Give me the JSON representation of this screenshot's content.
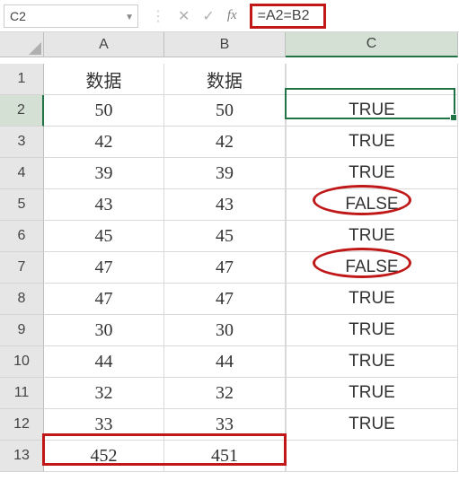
{
  "formula_bar": {
    "name_box": "C2",
    "formula": "=A2=B2"
  },
  "columns": [
    "A",
    "B",
    "C"
  ],
  "rows_header": [
    "1",
    "2",
    "3",
    "4",
    "5",
    "6",
    "7",
    "8",
    "9",
    "10",
    "11",
    "12",
    "13"
  ],
  "header_row": {
    "A": "数据",
    "B": "数据",
    "C": ""
  },
  "data": [
    {
      "A": "50",
      "B": "50",
      "C": "TRUE"
    },
    {
      "A": "42",
      "B": "42",
      "C": "TRUE"
    },
    {
      "A": "39",
      "B": "39",
      "C": "TRUE"
    },
    {
      "A": "43",
      "B": "43",
      "C": "FALSE"
    },
    {
      "A": "45",
      "B": "45",
      "C": "TRUE"
    },
    {
      "A": "47",
      "B": "47",
      "C": "FALSE"
    },
    {
      "A": "47",
      "B": "47",
      "C": "TRUE"
    },
    {
      "A": "30",
      "B": "30",
      "C": "TRUE"
    },
    {
      "A": "44",
      "B": "44",
      "C": "TRUE"
    },
    {
      "A": "32",
      "B": "32",
      "C": "TRUE"
    },
    {
      "A": "33",
      "B": "33",
      "C": "TRUE"
    },
    {
      "A": "452",
      "B": "451",
      "C": ""
    }
  ],
  "chart_data": {
    "type": "table",
    "columns": [
      "A 数据",
      "B 数据",
      "C"
    ],
    "rows": [
      [
        50,
        50,
        "TRUE"
      ],
      [
        42,
        42,
        "TRUE"
      ],
      [
        39,
        39,
        "TRUE"
      ],
      [
        43,
        43,
        "FALSE"
      ],
      [
        45,
        45,
        "TRUE"
      ],
      [
        47,
        47,
        "FALSE"
      ],
      [
        47,
        47,
        "TRUE"
      ],
      [
        30,
        30,
        "TRUE"
      ],
      [
        44,
        44,
        "TRUE"
      ],
      [
        32,
        32,
        "TRUE"
      ],
      [
        33,
        33,
        "TRUE"
      ],
      [
        452,
        451,
        ""
      ]
    ],
    "title": "",
    "formula": "=A2=B2",
    "active_cell": "C2"
  },
  "annotations": {
    "active_cell": "C2",
    "red_circles": [
      "C5",
      "C7"
    ],
    "red_boxes": [
      "formula",
      "row13_AB"
    ]
  }
}
